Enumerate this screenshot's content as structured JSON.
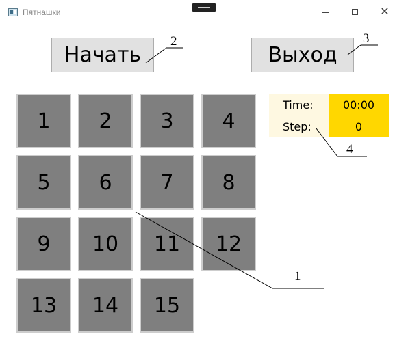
{
  "window": {
    "title": "Пятнашки",
    "icon": "app-icon",
    "close_glyph": "✕"
  },
  "buttons": {
    "start_label": "Начать",
    "exit_label": "Выход"
  },
  "board": {
    "tiles": [
      "1",
      "2",
      "3",
      "4",
      "5",
      "6",
      "7",
      "8",
      "9",
      "10",
      "11",
      "12",
      "13",
      "14",
      "15"
    ]
  },
  "info": {
    "time_label": "Time:",
    "time_value": "00:00",
    "step_label": "Step:",
    "step_value": "0"
  },
  "callouts": {
    "c1": "1",
    "c2": "2",
    "c3": "3",
    "c4": "4"
  },
  "colors": {
    "tile_bg": "#7f7f7f",
    "tile_border": "#cdcdcd",
    "info_label_bg": "#fef8e1",
    "info_value_bg": "#ffd700",
    "button_bg": "#e1e1e1"
  }
}
